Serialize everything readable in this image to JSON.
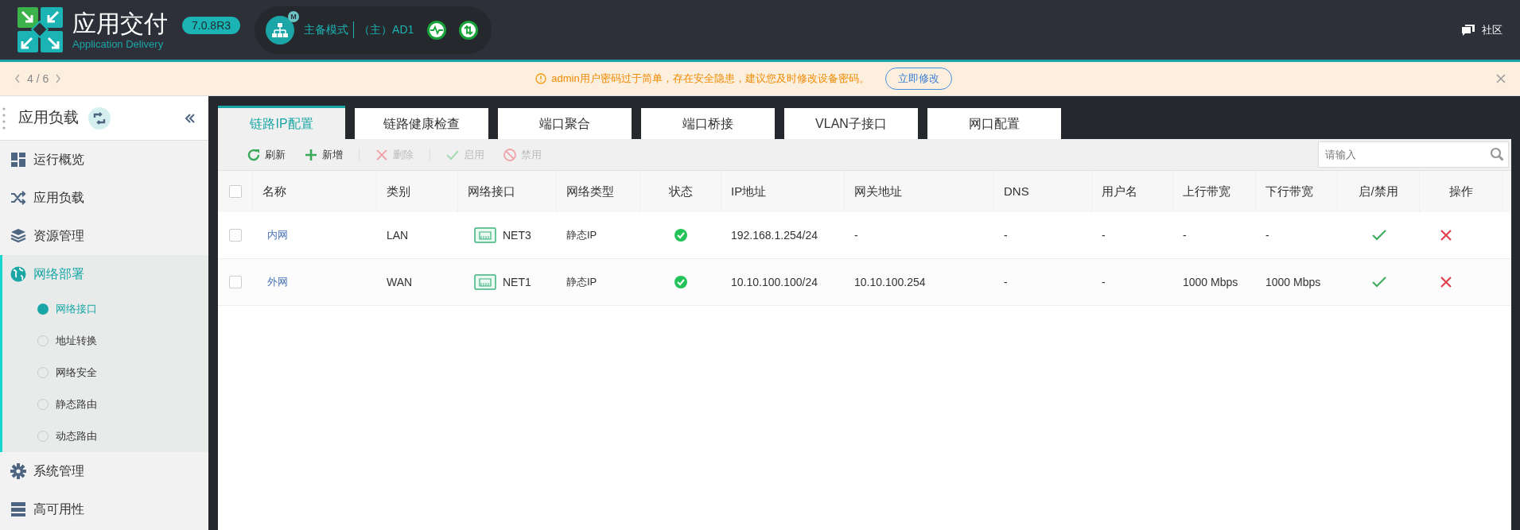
{
  "header": {
    "logo_title": "应用交付",
    "logo_subtitle": "Application Delivery",
    "version": "7.0.8R3",
    "mode_badge": "M",
    "mode": "主备模式",
    "device": "（主）AD1",
    "community": "社区"
  },
  "notice": {
    "pager": "4 / 6",
    "message": "admin用户密码过于简单，存在安全隐患，建议您及时修改设备密码。",
    "action": "立即修改"
  },
  "sidebar": {
    "title": "应用负载",
    "items": [
      {
        "label": "运行概览",
        "kind": "grid",
        "selected": false
      },
      {
        "label": "应用负载",
        "kind": "shuffle",
        "selected": false
      },
      {
        "label": "资源管理",
        "kind": "layers",
        "selected": false
      },
      {
        "label": "网络部署",
        "kind": "globe",
        "selected": true,
        "children": [
          {
            "label": "网络接口",
            "selected": true
          },
          {
            "label": "地址转换",
            "selected": false
          },
          {
            "label": "网络安全",
            "selected": false
          },
          {
            "label": "静态路由",
            "selected": false
          },
          {
            "label": "动态路由",
            "selected": false
          }
        ]
      },
      {
        "label": "系统管理",
        "kind": "gear",
        "selected": false
      },
      {
        "label": "高可用性",
        "kind": "server",
        "selected": false
      }
    ]
  },
  "tabs": [
    {
      "label": "链路IP配置",
      "selected": true
    },
    {
      "label": "链路健康检查",
      "selected": false
    },
    {
      "label": "端口聚合",
      "selected": false
    },
    {
      "label": "端口桥接",
      "selected": false
    },
    {
      "label": "VLAN子接口",
      "selected": false
    },
    {
      "label": "网口配置",
      "selected": false
    }
  ],
  "toolbar": {
    "buttons": [
      {
        "label": "刷新",
        "kind": "refresh",
        "disabled": false
      },
      {
        "label": "新增",
        "kind": "add",
        "disabled": false
      },
      {
        "label": "删除",
        "kind": "delete",
        "disabled": true
      },
      {
        "label": "启用",
        "kind": "enable",
        "disabled": true
      },
      {
        "label": "禁用",
        "kind": "disable",
        "disabled": true
      }
    ],
    "search_placeholder": "请输入"
  },
  "table": {
    "all_checked": false,
    "columns": [
      "名称",
      "类别",
      "网络接口",
      "网络类型",
      "状态",
      "IP地址",
      "网关地址",
      "DNS",
      "用户名",
      "上行带宽",
      "下行带宽",
      "启/禁用",
      "操作"
    ],
    "rows": [
      {
        "checked": false,
        "name": "内网",
        "type": "LAN",
        "interface": "NET3",
        "net_type": "静态IP",
        "status_ok": true,
        "ip": "192.168.1.254/24",
        "gateway": "-",
        "dns": "-",
        "user": "-",
        "up": "-",
        "down": "-",
        "enabled": true
      },
      {
        "checked": false,
        "name": "外网",
        "type": "WAN",
        "interface": "NET1",
        "net_type": "静态IP",
        "status_ok": true,
        "ip": "10.10.100.100/24",
        "gateway": "10.10.100.254",
        "dns": "-",
        "user": "-",
        "up": "1000 Mbps",
        "down": "1000 Mbps",
        "enabled": true
      }
    ]
  }
}
